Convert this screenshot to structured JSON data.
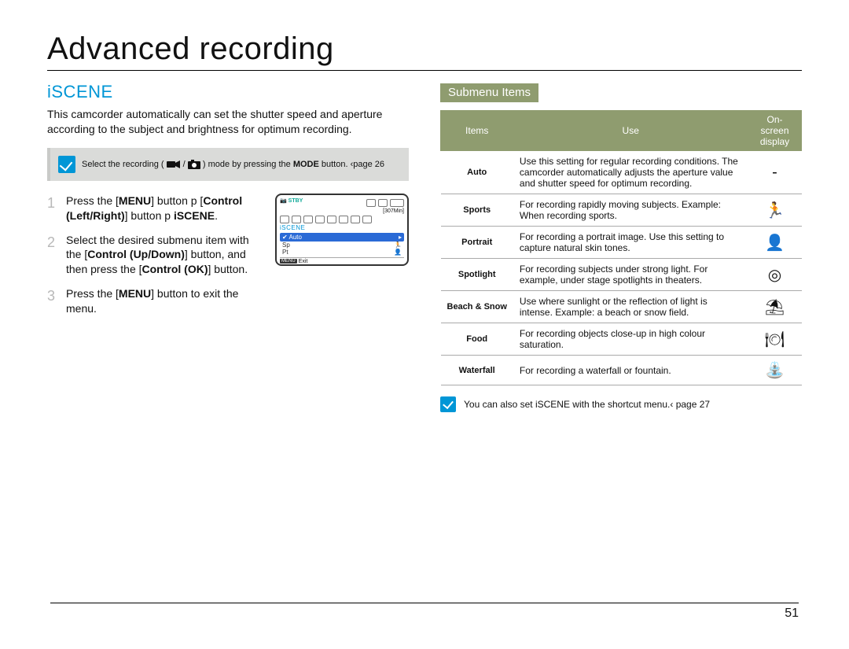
{
  "page_title": "Advanced recording",
  "page_number": "51",
  "left": {
    "section_title": "iSCENE",
    "intro": "This camcorder automatically can set the shutter speed and aperture according to the subject and brightness for optimum recording.",
    "note": {
      "prefix": "Select the recording (",
      "suffix": ") mode by pressing the ",
      "bold": "MODE",
      "after": " button. ‹page 26"
    },
    "steps": [
      {
        "num": "1",
        "parts": [
          {
            "t": "Press the ["
          },
          {
            "b": "MENU"
          },
          {
            "t": "] button p ["
          },
          {
            "b": "Control (Left/Right)"
          },
          {
            "t": "] button  p "
          },
          {
            "b": "iSCENE"
          },
          {
            "t": "."
          }
        ]
      },
      {
        "num": "2",
        "parts": [
          {
            "t": "Select the desired submenu item with the ["
          },
          {
            "b": "Control (Up/Down)"
          },
          {
            "t": "] button, and then press the ["
          },
          {
            "b": "Control (OK)"
          },
          {
            "t": "] button."
          }
        ]
      },
      {
        "num": "3",
        "parts": [
          {
            "t": "Press the ["
          },
          {
            "b": "MENU"
          },
          {
            "t": "] button to exit the menu."
          }
        ]
      }
    ],
    "lcd": {
      "stby": "STBY",
      "time": "[307Min]",
      "label": "iSCENE",
      "selected": "Auto",
      "row2_left": "Sp",
      "row3_left": "Pt",
      "menu_label": "Exit"
    }
  },
  "right": {
    "submenu_tag": "Submenu Items",
    "headers": {
      "items": "Items",
      "use": "Use",
      "osd": "On-screen display"
    },
    "rows": [
      {
        "item": "Auto",
        "use": "Use this setting for regular recording conditions. The camcorder automatically adjusts the aperture value and shutter speed for optimum recording.",
        "icon": "-"
      },
      {
        "item": "Sports",
        "use": "For recording rapidly moving subjects. Example: When recording sports.",
        "icon": "🏃"
      },
      {
        "item": "Portrait",
        "use": "For recording a portrait image. Use this setting to capture natural skin tones.",
        "icon": "👤"
      },
      {
        "item": "Spotlight",
        "use": "For recording subjects under strong light. For example, under stage spotlights in theaters.",
        "icon": "◎"
      },
      {
        "item": "Beach & Snow",
        "use": "Use where sunlight or the reﬂection of light is intense. Example: a beach or snow ﬁeld.",
        "icon": "⛱"
      },
      {
        "item": "Food",
        "use": "For recording objects close-up in high colour saturation.",
        "icon": "🍽"
      },
      {
        "item": "Waterfall",
        "use": "For recording a waterfall or fountain.",
        "icon": "⛲"
      }
    ],
    "post_note": "You can also set iSCENE with the shortcut menu.‹ page 27"
  }
}
